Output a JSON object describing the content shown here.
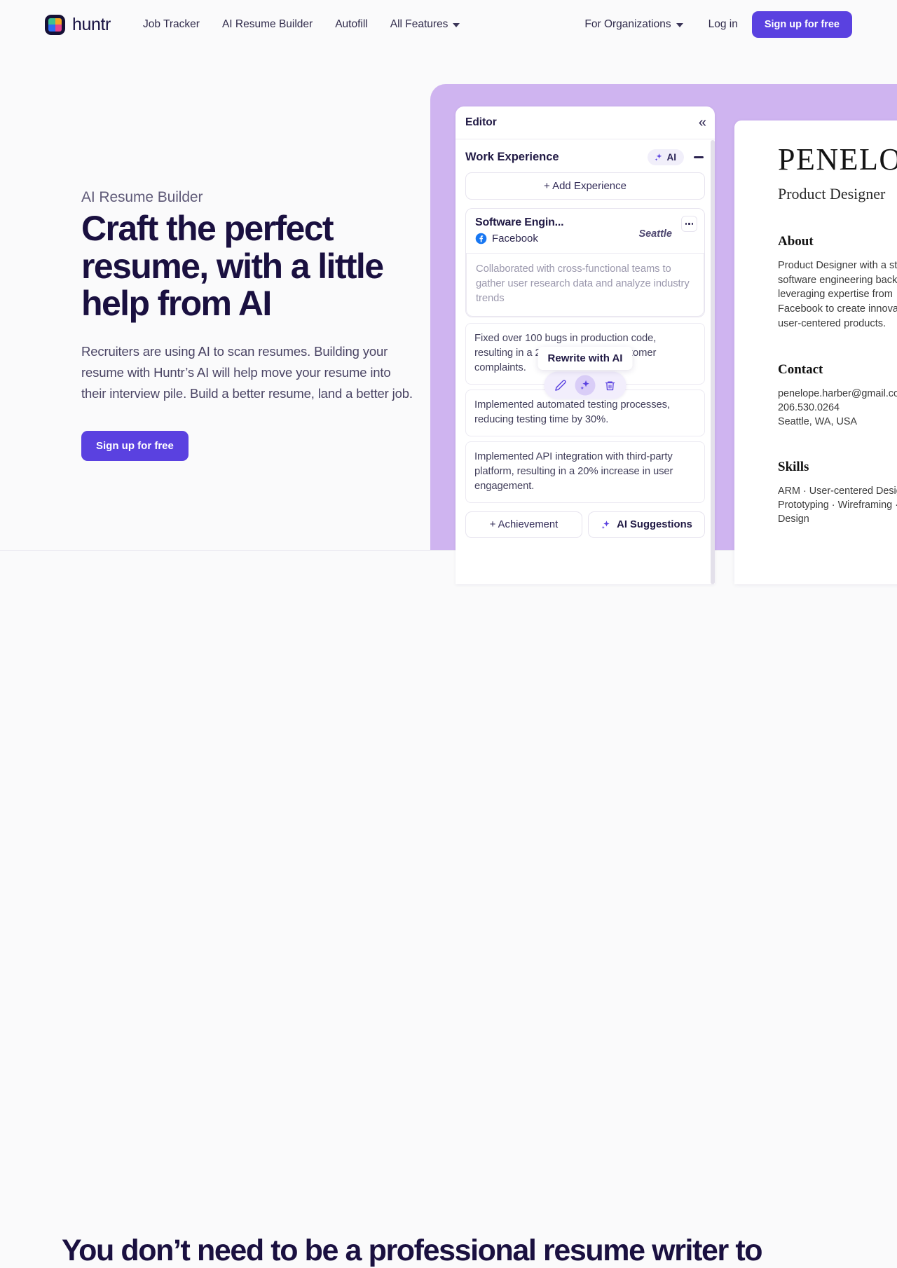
{
  "brand": {
    "name": "huntr",
    "logo_colors": [
      "#3ec28f",
      "#f5a623",
      "#2d6cf6",
      "#e8448c"
    ]
  },
  "nav": {
    "links": [
      {
        "label": "Job Tracker",
        "has_caret": false
      },
      {
        "label": "AI Resume Builder",
        "has_caret": false
      },
      {
        "label": "Autofill",
        "has_caret": false
      },
      {
        "label": "All Features",
        "has_caret": true
      }
    ],
    "right": {
      "organizations": "For Organizations",
      "login": "Log in",
      "signup": "Sign up for free"
    }
  },
  "hero": {
    "eyebrow": "AI Resume Builder",
    "title": "Craft the perfect resume, with a little help from AI",
    "body": "Recruiters are using AI to scan resumes. Building your resume with Huntr’s AI will help move your resume into their interview pile. Build a better resume, land a better job.",
    "cta": "Sign up for free"
  },
  "editor": {
    "title": "Editor",
    "collapse_icon": "«",
    "section": {
      "title": "Work Experience",
      "ai_badge": "AI",
      "add_experience": "+ Add Experience"
    },
    "experience": {
      "role": "Software Engin...",
      "company": "Facebook",
      "location": "Seattle",
      "bullets": [
        "Collaborated with cross-functional teams to gather user research data and analyze industry trends",
        "Fixed over 100 bugs in production code, resulting in a 20% decrease in customer complaints.",
        "Implemented automated testing processes, reducing testing time by 30%.",
        "Implemented API integration with third-party platform, resulting in a 20% increase in user engagement."
      ]
    },
    "tooltip": "Rewrite with AI",
    "actions": {
      "add_achievement": "+ Achievement",
      "ai_suggestions": "AI Suggestions"
    }
  },
  "resume": {
    "name": "PENELOPE",
    "role": "Product Designer",
    "about_heading": "About",
    "about_text": "Product Designer with a strong software engineering background leveraging expertise from Facebook to create innovative and user-centered products.",
    "contact_heading": "Contact",
    "contact_email": "penelope.harber@gmail.com",
    "contact_phone": "206.530.0264",
    "contact_location": "Seattle, WA, USA",
    "skills_heading": "Skills",
    "skills_text": "ARM · User-centered Design · Prototyping · Wireframing · UX Design"
  },
  "lower_section": {
    "title": "You don’t need to be a professional resume writer to"
  },
  "colors": {
    "accent": "#5a41e0",
    "showcase_bg": "#cfb4f0",
    "page_bg": "#fafafb",
    "ink": "#1a1040"
  }
}
